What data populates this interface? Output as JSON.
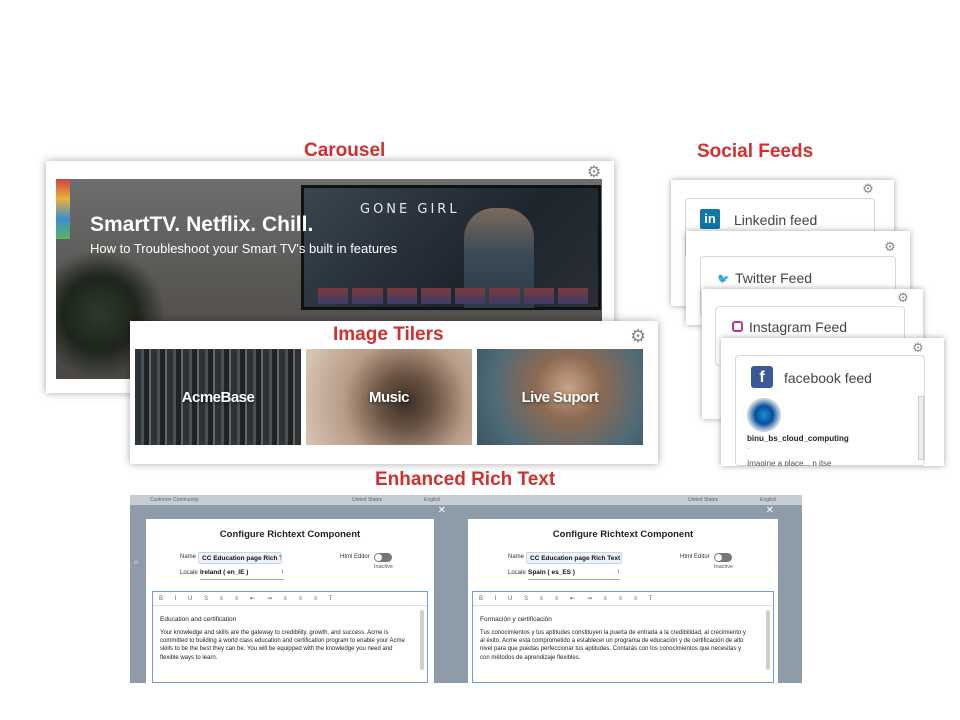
{
  "sections": {
    "carousel_title": "Carousel",
    "social_title": "Social Feeds",
    "tilers_title": "Image Tilers",
    "richtext_title": "Enhanced Rich Text"
  },
  "carousel": {
    "heading": "SmartTV. Netflix. Chill.",
    "subheading": "How to Troubleshoot your Smart TV's built in features",
    "tv_title": "GONE GIRL",
    "settings_icon": "gear-icon"
  },
  "tilers": {
    "tiles": [
      {
        "label": "AcmeBase"
      },
      {
        "label": "Music"
      },
      {
        "label": "Live Suport"
      }
    ]
  },
  "social": {
    "linkedin": "Linkedin feed",
    "twitter": "Twitter Feed",
    "instagram": "Instagram Feed",
    "facebook": "facebook feed",
    "facebook_user": "binu_bs_cloud_computing",
    "facebook_dot": "·",
    "facebook_partial": "Imagine a place... n itse"
  },
  "richtext": {
    "panels": [
      {
        "topbar_left": "Customer Community",
        "topbar_right": "United States",
        "topbar_far": "English",
        "title": "Configure Richtext Component",
        "name_label": "Name",
        "name_value": "CC Education page Rich Te",
        "html_editor_label": "Html Editor",
        "toggle_state": "Inactive",
        "locale_label": "Locale",
        "locale_value": "Ireland ( en_IE )",
        "toolbar": "B I U S ≡ ≡ ⇤ ⇥ ≡ ≡ ≡ T",
        "heading": "Education and certification",
        "body": "Your knowledge and skills are the gateway to credibility, growth, and success. Acme is committed to building a world class education and certification program to enable your Acme skills to be the best they can be. You will be equipped with the knowledge you need and flexible ways to learn."
      },
      {
        "topbar_left": "",
        "topbar_right": "United States",
        "topbar_far": "English",
        "title": "Configure Richtext Component",
        "name_label": "Name",
        "name_value": "CC Education page Rich Text",
        "html_editor_label": "Html Editor",
        "toggle_state": "Inactive",
        "locale_label": "Locale",
        "locale_value": "Spain ( es_ES )",
        "toolbar": "B I U S ≡ ≡ ⇤ ⇥ ≡ ≡ ≡ T",
        "heading": "Formación y certificación",
        "body": "Tus conocimientos y tus aptitudes constituyen la puerta de entrada a la credibilidad, al crecimiento y al éxito. Acme está comprometido a establecer un programa de educación y de certificación de alto nivel para que puedas perfeccionar tus aptitudes. Contarás con los conocimientos que necesitas y con métodos de aprendizaje flexibles."
      }
    ]
  }
}
